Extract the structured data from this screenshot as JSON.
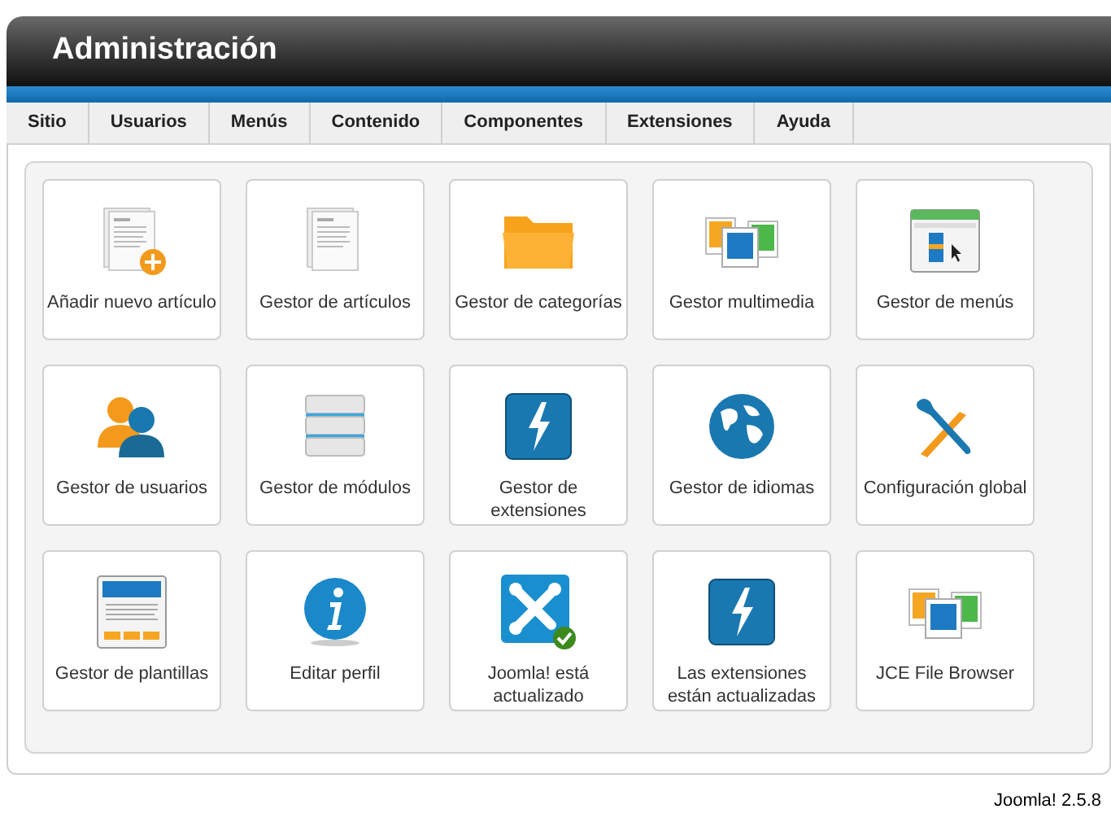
{
  "header": {
    "title": "Administración"
  },
  "menu": [
    "Sitio",
    "Usuarios",
    "Menús",
    "Contenido",
    "Componentes",
    "Extensiones",
    "Ayuda"
  ],
  "tiles": [
    {
      "label": "Añadir nuevo artículo"
    },
    {
      "label": "Gestor de artículos"
    },
    {
      "label": "Gestor de categorías"
    },
    {
      "label": "Gestor multimedia"
    },
    {
      "label": "Gestor de menús"
    },
    {
      "label": "Gestor de usuarios"
    },
    {
      "label": "Gestor de módulos"
    },
    {
      "label": "Gestor de extensiones"
    },
    {
      "label": "Gestor de idiomas"
    },
    {
      "label": "Configuración global"
    },
    {
      "label": "Gestor de plantillas"
    },
    {
      "label": "Editar perfil"
    },
    {
      "label": "Joomla! está actualizado"
    },
    {
      "label": "Las extensiones están actualizadas"
    },
    {
      "label": "JCE File Browser"
    }
  ],
  "footer": {
    "version": "Joomla! 2.5.8"
  }
}
